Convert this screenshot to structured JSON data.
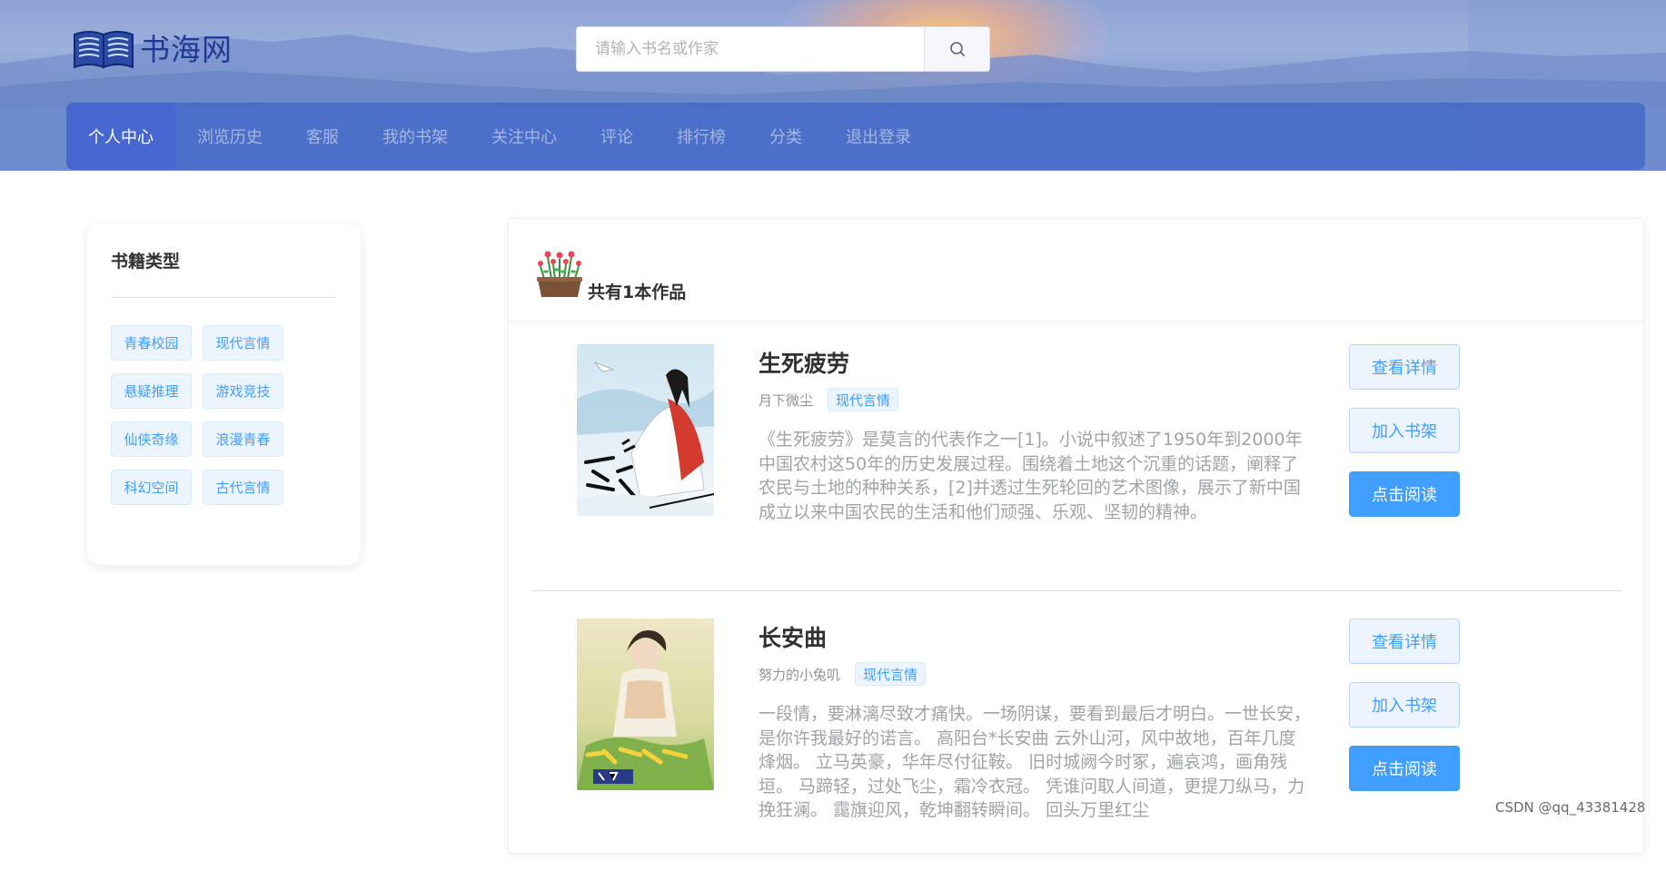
{
  "header": {
    "logo_text": "书海网",
    "search": {
      "placeholder": "请输入书名或作家",
      "value": ""
    },
    "nav": [
      {
        "label": "个人中心",
        "active": true
      },
      {
        "label": "浏览历史",
        "active": false
      },
      {
        "label": "客服",
        "active": false
      },
      {
        "label": "我的书架",
        "active": false
      },
      {
        "label": "关注中心",
        "active": false
      },
      {
        "label": "评论",
        "active": false
      },
      {
        "label": "排行榜",
        "active": false
      },
      {
        "label": "分类",
        "active": false
      },
      {
        "label": "退出登录",
        "active": false
      }
    ]
  },
  "sidebar": {
    "title": "书籍类型",
    "tags": [
      "青春校园",
      "现代言情",
      "悬疑推理",
      "游戏竞技",
      "仙侠奇缘",
      "浪漫青春",
      "科幻空间",
      "古代言情"
    ]
  },
  "main": {
    "count_text": "共有1本作品",
    "books": [
      {
        "title": "生死疲劳",
        "author": "月下微尘",
        "tag": "现代言情",
        "description": "《生死疲劳》是莫言的代表作之一[1]。小说中叙述了1950年到2000年中国农村这50年的历史发展过程。围绕着土地这个沉重的话题，阐释了农民与土地的种种关系，[2]并透过生死轮回的艺术图像，展示了新中国成立以来中国农民的生活和他们顽强、乐观、坚韧的精神。",
        "buttons": {
          "detail": "查看详情",
          "shelf": "加入书架",
          "read": "点击阅读"
        }
      },
      {
        "title": "长安曲",
        "author": "努力的小兔叽",
        "tag": "现代言情",
        "description": "一段情，要淋漓尽致才痛快。一场阴谋，要看到最后才明白。一世长安，是你许我最好的诺言。 高阳台*长安曲 云外山河，风中故地，百年几度烽烟。 立马英豪，华年尽付征鞍。 旧时城阙今时冢，遍哀鸿，画角残垣。 马蹄轻，过处飞尘，霜冷衣冠。 凭谁问取人间道，更提刀纵马，力挽狂澜。 靄旗迎风，乾坤翻转瞬间。 回头万里红尘",
        "buttons": {
          "detail": "查看详情",
          "shelf": "加入书架",
          "read": "点击阅读"
        }
      }
    ]
  },
  "watermark": "CSDN @qq_43381428",
  "colors": {
    "accent": "#409eff",
    "nav_active": "#4766cf",
    "logo": "#1f3a96"
  }
}
